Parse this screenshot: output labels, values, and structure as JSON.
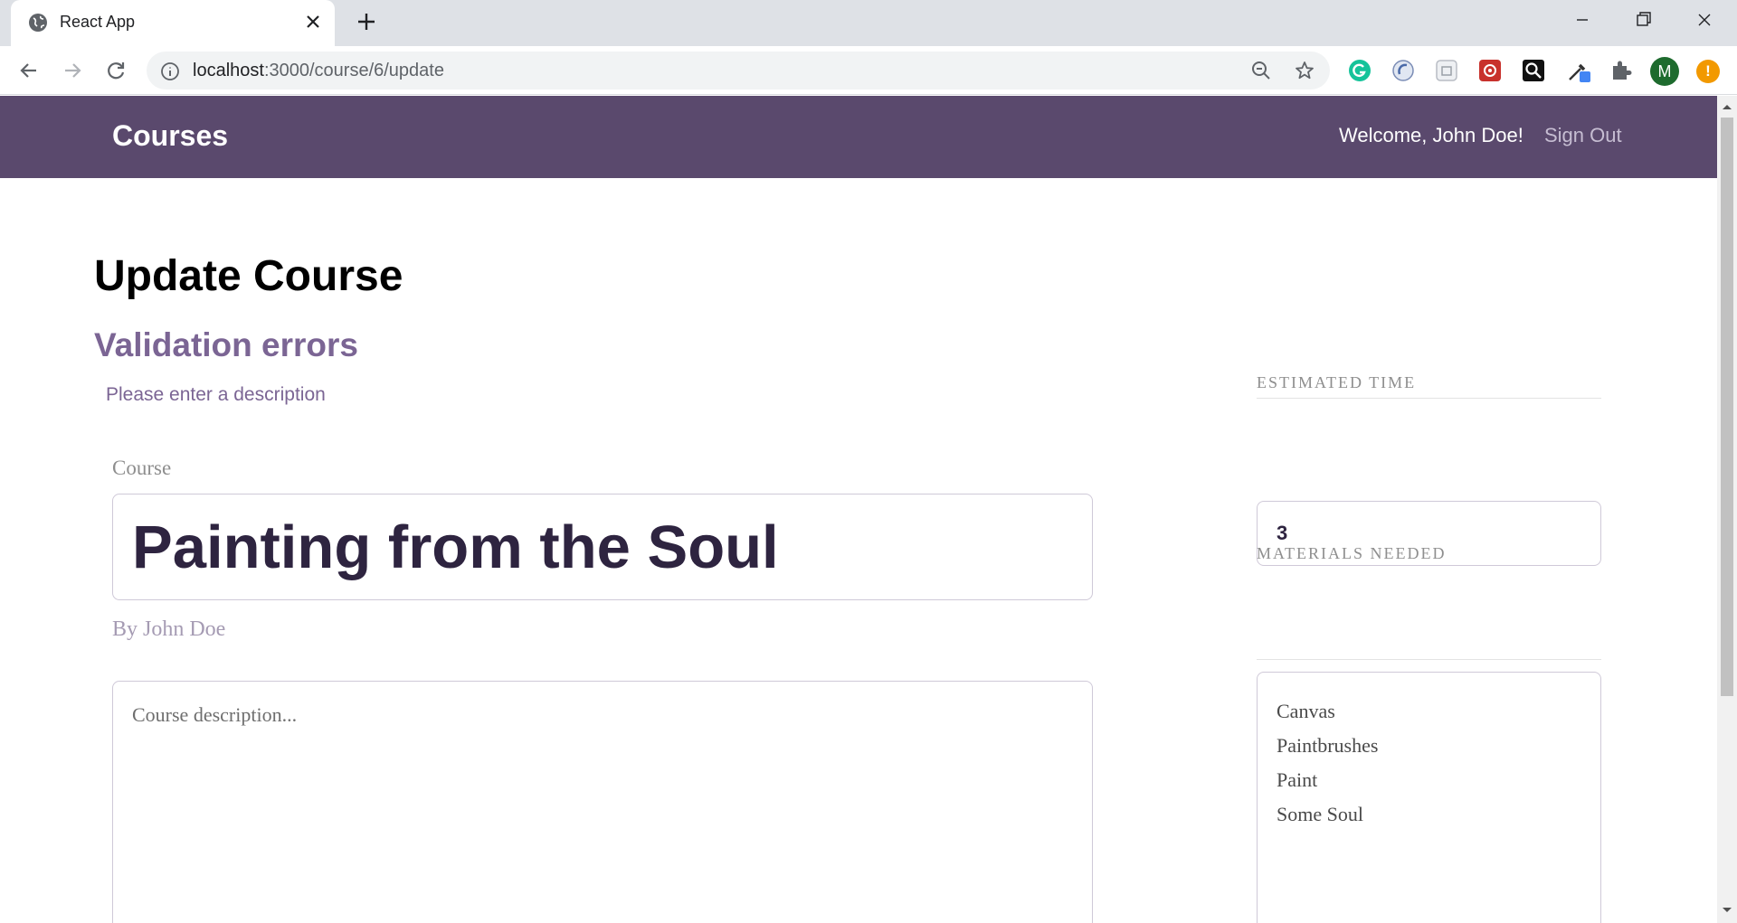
{
  "browser": {
    "tab_title": "React App",
    "url_host": "localhost",
    "url_rest": ":3000/course/6/update",
    "profile_initial": "M",
    "update_badge": "!",
    "extensions": [
      "grammarly-icon",
      "sync-icon",
      "extension-square-icon",
      "extension-red-icon",
      "search-extension-icon",
      "eyedropper-icon",
      "puzzle-icon"
    ]
  },
  "header": {
    "title": "Courses",
    "welcome": "Welcome, John Doe!",
    "signout": "Sign Out",
    "bg_color": "#5a496d"
  },
  "page": {
    "title": "Update Course",
    "validation_heading": "Validation errors",
    "validation_errors": [
      "Please enter a description"
    ]
  },
  "form": {
    "course_label": "Course",
    "course_title": "Painting from the Soul",
    "author": "By John Doe",
    "description_placeholder": "Course description...",
    "description_value": "",
    "estimated_time_label": "ESTIMATED TIME",
    "estimated_time": "3",
    "materials_label": "MATERIALS NEEDED",
    "materials": [
      "Canvas",
      "Paintbrushes",
      "Paint",
      "Some Soul"
    ]
  }
}
